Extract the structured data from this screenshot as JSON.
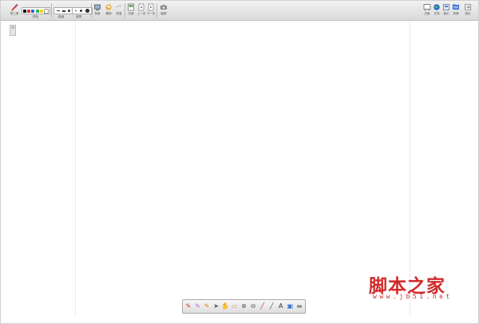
{
  "topbar": {
    "pen_label": "笔工具",
    "color_label": "颜色",
    "width_label": "粗细",
    "clear_label": "清屏",
    "bg_label": "背景",
    "undo_label": "撤销",
    "redo_label": "恢复",
    "page_label": "页面",
    "prev_label": "上一页",
    "next_label": "下一页",
    "screenshot_label": "截屏",
    "right_tools": [
      {
        "label": "白板"
      },
      {
        "label": "文档"
      },
      {
        "label": "演示"
      },
      {
        "label": "资源"
      },
      {
        "label": "退出"
      }
    ]
  },
  "palette": {
    "colors": [
      "#000000",
      "#e52b2b",
      "#2a62d8",
      "#2bb14b",
      "#f3d21b",
      "#ffffff"
    ]
  },
  "widths": [
    "细",
    "中",
    "粗"
  ],
  "side_handle": "≡",
  "bottom_toolbar": {
    "tools": [
      {
        "name": "pen-icon",
        "glyph": "✎",
        "color": "#d33"
      },
      {
        "name": "highlighter-icon",
        "glyph": "✎",
        "color": "#b6c"
      },
      {
        "name": "brush-icon",
        "glyph": "✎",
        "color": "#d80"
      },
      {
        "name": "pointer-icon",
        "glyph": "➤",
        "color": "#555"
      },
      {
        "name": "hand-icon",
        "glyph": "✋",
        "color": "#d96"
      },
      {
        "name": "eraser-icon",
        "glyph": "▭",
        "color": "#c97"
      },
      {
        "name": "zoom-in-icon",
        "glyph": "⊕",
        "color": "#666"
      },
      {
        "name": "zoom-out-icon",
        "glyph": "⊖",
        "color": "#666"
      },
      {
        "name": "line-icon",
        "glyph": "╱",
        "color": "#c33"
      },
      {
        "name": "ruler-icon",
        "glyph": "╱",
        "color": "#555"
      },
      {
        "name": "text-icon",
        "glyph": "A",
        "color": "#333"
      },
      {
        "name": "image-icon",
        "glyph": "▣",
        "color": "#37c"
      },
      {
        "name": "keyboard-icon",
        "glyph": "▬",
        "color": "#888"
      }
    ]
  },
  "watermark": {
    "cn": "脚本之家",
    "url": "www.jb51.net"
  }
}
